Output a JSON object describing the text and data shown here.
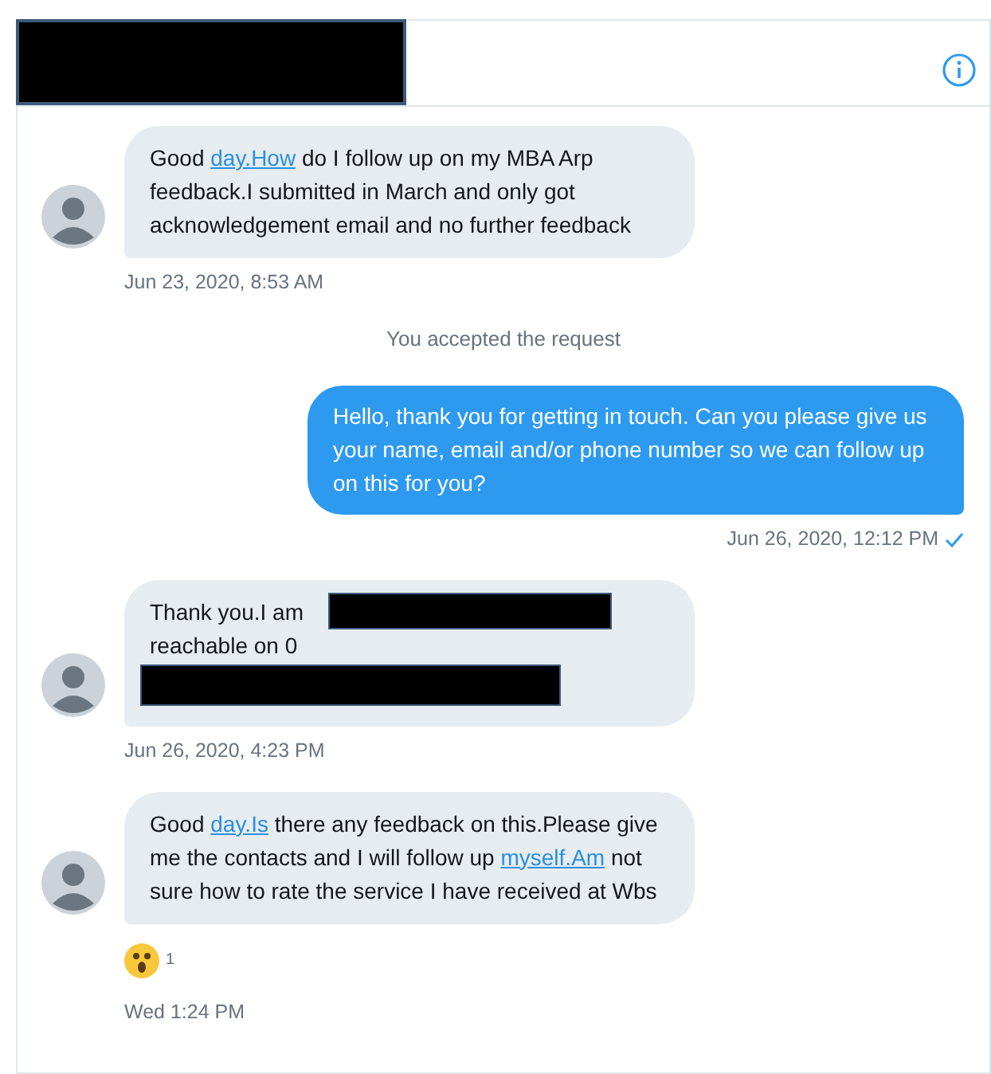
{
  "header": {
    "redacted": true
  },
  "messages": [
    {
      "kind": "incoming",
      "segments": [
        {
          "kind": "text",
          "text": "Good "
        },
        {
          "kind": "link",
          "text": "day.How"
        },
        {
          "kind": "text",
          "text": " do I follow up on my MBA Arp feedback.I submitted in March and only got acknowledgement email and no further feedback"
        }
      ],
      "time": "Jun 23, 2020, 8:53 AM"
    },
    {
      "kind": "system",
      "text": "You accepted the request"
    },
    {
      "kind": "outgoing",
      "segments": [
        {
          "kind": "text",
          "text": "Hello, thank you for getting in touch. Can you please give us your name, email and/or phone number so we can follow up on this for you?"
        }
      ],
      "time": "Jun 26, 2020, 12:12 PM",
      "read": true
    },
    {
      "kind": "incoming",
      "segments": [
        {
          "kind": "text",
          "text": "Thank you.I am"
        },
        {
          "kind": "break"
        },
        {
          "kind": "text",
          "text": "reachable on 0"
        }
      ],
      "redacted": true,
      "time": "Jun 26, 2020, 4:23 PM"
    },
    {
      "kind": "incoming",
      "segments": [
        {
          "kind": "text",
          "text": "Good "
        },
        {
          "kind": "link",
          "text": "day.Is"
        },
        {
          "kind": "text",
          "text": " there any feedback on this.Please give me the contacts and I will follow up "
        },
        {
          "kind": "link",
          "text": "myself.Am"
        },
        {
          "kind": "text",
          "text": " not sure how to rate the service I have received at Wbs"
        }
      ],
      "reaction": {
        "count": "1"
      },
      "time": "Wed 1:24 PM"
    }
  ]
}
